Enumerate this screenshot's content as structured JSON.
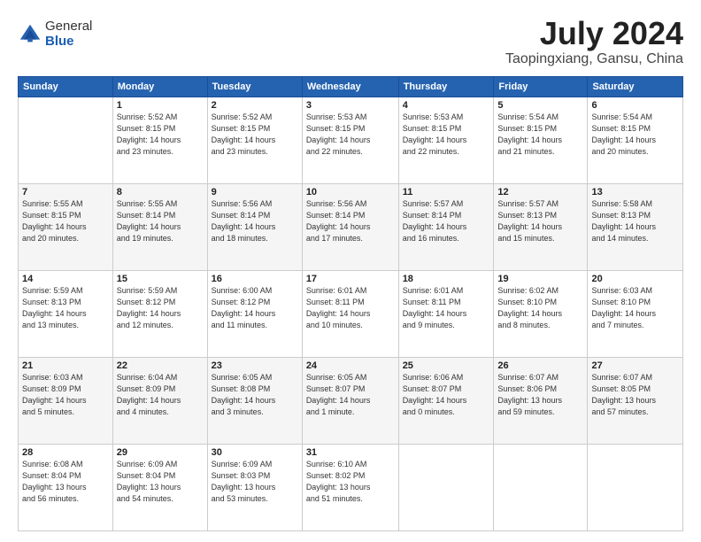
{
  "logo": {
    "general": "General",
    "blue": "Blue"
  },
  "title": "July 2024",
  "location": "Taopingxiang, Gansu, China",
  "headers": [
    "Sunday",
    "Monday",
    "Tuesday",
    "Wednesday",
    "Thursday",
    "Friday",
    "Saturday"
  ],
  "weeks": [
    [
      {
        "day": "",
        "info": ""
      },
      {
        "day": "1",
        "info": "Sunrise: 5:52 AM\nSunset: 8:15 PM\nDaylight: 14 hours\nand 23 minutes."
      },
      {
        "day": "2",
        "info": "Sunrise: 5:52 AM\nSunset: 8:15 PM\nDaylight: 14 hours\nand 23 minutes."
      },
      {
        "day": "3",
        "info": "Sunrise: 5:53 AM\nSunset: 8:15 PM\nDaylight: 14 hours\nand 22 minutes."
      },
      {
        "day": "4",
        "info": "Sunrise: 5:53 AM\nSunset: 8:15 PM\nDaylight: 14 hours\nand 22 minutes."
      },
      {
        "day": "5",
        "info": "Sunrise: 5:54 AM\nSunset: 8:15 PM\nDaylight: 14 hours\nand 21 minutes."
      },
      {
        "day": "6",
        "info": "Sunrise: 5:54 AM\nSunset: 8:15 PM\nDaylight: 14 hours\nand 20 minutes."
      }
    ],
    [
      {
        "day": "7",
        "info": "Sunrise: 5:55 AM\nSunset: 8:15 PM\nDaylight: 14 hours\nand 20 minutes."
      },
      {
        "day": "8",
        "info": "Sunrise: 5:55 AM\nSunset: 8:14 PM\nDaylight: 14 hours\nand 19 minutes."
      },
      {
        "day": "9",
        "info": "Sunrise: 5:56 AM\nSunset: 8:14 PM\nDaylight: 14 hours\nand 18 minutes."
      },
      {
        "day": "10",
        "info": "Sunrise: 5:56 AM\nSunset: 8:14 PM\nDaylight: 14 hours\nand 17 minutes."
      },
      {
        "day": "11",
        "info": "Sunrise: 5:57 AM\nSunset: 8:14 PM\nDaylight: 14 hours\nand 16 minutes."
      },
      {
        "day": "12",
        "info": "Sunrise: 5:57 AM\nSunset: 8:13 PM\nDaylight: 14 hours\nand 15 minutes."
      },
      {
        "day": "13",
        "info": "Sunrise: 5:58 AM\nSunset: 8:13 PM\nDaylight: 14 hours\nand 14 minutes."
      }
    ],
    [
      {
        "day": "14",
        "info": "Sunrise: 5:59 AM\nSunset: 8:13 PM\nDaylight: 14 hours\nand 13 minutes."
      },
      {
        "day": "15",
        "info": "Sunrise: 5:59 AM\nSunset: 8:12 PM\nDaylight: 14 hours\nand 12 minutes."
      },
      {
        "day": "16",
        "info": "Sunrise: 6:00 AM\nSunset: 8:12 PM\nDaylight: 14 hours\nand 11 minutes."
      },
      {
        "day": "17",
        "info": "Sunrise: 6:01 AM\nSunset: 8:11 PM\nDaylight: 14 hours\nand 10 minutes."
      },
      {
        "day": "18",
        "info": "Sunrise: 6:01 AM\nSunset: 8:11 PM\nDaylight: 14 hours\nand 9 minutes."
      },
      {
        "day": "19",
        "info": "Sunrise: 6:02 AM\nSunset: 8:10 PM\nDaylight: 14 hours\nand 8 minutes."
      },
      {
        "day": "20",
        "info": "Sunrise: 6:03 AM\nSunset: 8:10 PM\nDaylight: 14 hours\nand 7 minutes."
      }
    ],
    [
      {
        "day": "21",
        "info": "Sunrise: 6:03 AM\nSunset: 8:09 PM\nDaylight: 14 hours\nand 5 minutes."
      },
      {
        "day": "22",
        "info": "Sunrise: 6:04 AM\nSunset: 8:09 PM\nDaylight: 14 hours\nand 4 minutes."
      },
      {
        "day": "23",
        "info": "Sunrise: 6:05 AM\nSunset: 8:08 PM\nDaylight: 14 hours\nand 3 minutes."
      },
      {
        "day": "24",
        "info": "Sunrise: 6:05 AM\nSunset: 8:07 PM\nDaylight: 14 hours\nand 1 minute."
      },
      {
        "day": "25",
        "info": "Sunrise: 6:06 AM\nSunset: 8:07 PM\nDaylight: 14 hours\nand 0 minutes."
      },
      {
        "day": "26",
        "info": "Sunrise: 6:07 AM\nSunset: 8:06 PM\nDaylight: 13 hours\nand 59 minutes."
      },
      {
        "day": "27",
        "info": "Sunrise: 6:07 AM\nSunset: 8:05 PM\nDaylight: 13 hours\nand 57 minutes."
      }
    ],
    [
      {
        "day": "28",
        "info": "Sunrise: 6:08 AM\nSunset: 8:04 PM\nDaylight: 13 hours\nand 56 minutes."
      },
      {
        "day": "29",
        "info": "Sunrise: 6:09 AM\nSunset: 8:04 PM\nDaylight: 13 hours\nand 54 minutes."
      },
      {
        "day": "30",
        "info": "Sunrise: 6:09 AM\nSunset: 8:03 PM\nDaylight: 13 hours\nand 53 minutes."
      },
      {
        "day": "31",
        "info": "Sunrise: 6:10 AM\nSunset: 8:02 PM\nDaylight: 13 hours\nand 51 minutes."
      },
      {
        "day": "",
        "info": ""
      },
      {
        "day": "",
        "info": ""
      },
      {
        "day": "",
        "info": ""
      }
    ]
  ]
}
